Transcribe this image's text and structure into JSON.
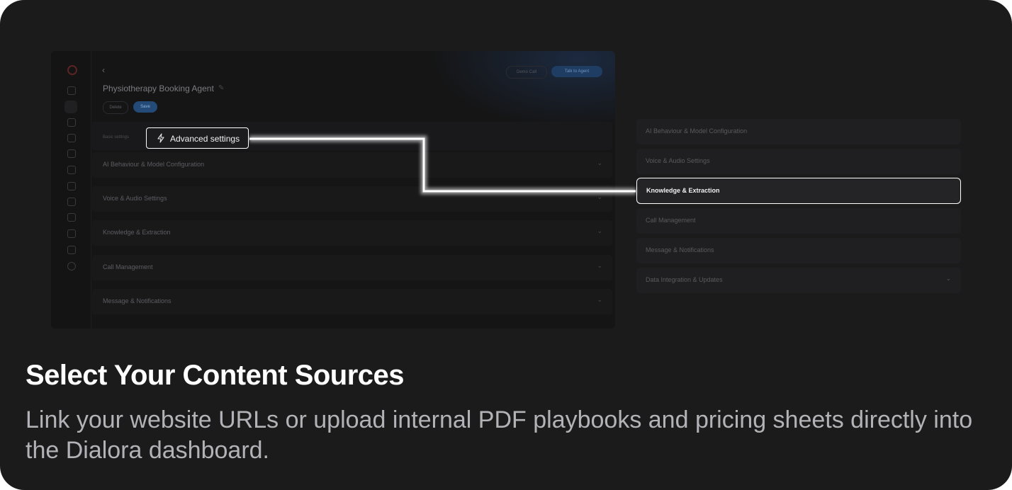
{
  "mockup": {
    "back_glyph": "‹",
    "agent_title": "Physiotherapy Booking Agent",
    "edit_glyph": "✎",
    "delete_label": "Delete",
    "save_label": "Save",
    "demo_call_label": "Demo Call",
    "talk_to_agent_label": "Talk to Agent",
    "toggle_text": "Basic settings",
    "sections": [
      {
        "label": "AI Behaviour & Model Configuration",
        "chevron": "⌄"
      },
      {
        "label": "Voice & Audio Settings",
        "chevron": "⌄"
      },
      {
        "label": "Knowledge & Extraction",
        "chevron": "⌄"
      },
      {
        "label": "Call Management",
        "chevron": "⌄"
      },
      {
        "label": "Message & Notifications",
        "chevron": "⌄"
      }
    ]
  },
  "callout": {
    "label": "Advanced settings",
    "icon": "lightning-bolt-icon"
  },
  "panel": {
    "sections": [
      {
        "label": "AI Behaviour & Model Configuration",
        "chevron": ""
      },
      {
        "label": "Voice & Audio Settings",
        "chevron": ""
      },
      {
        "label": "Knowledge & Extraction",
        "chevron": "",
        "highlighted": true
      },
      {
        "label": "Call Management",
        "chevron": ""
      },
      {
        "label": "Message & Notifications",
        "chevron": ""
      },
      {
        "label": "Data Integration & Updates",
        "chevron": "⌄"
      }
    ]
  },
  "headline": "Select Your Content Sources",
  "description": "Link your website URLs or upload internal PDF playbooks and pricing sheets directly into the Dialora dashboard.",
  "colors": {
    "background": "#1b1b1c",
    "highlight_border": "#ffffff",
    "accent_blue": "#244a78"
  }
}
